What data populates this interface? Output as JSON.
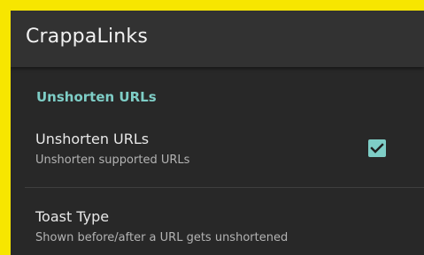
{
  "app": {
    "title": "CrappaLinks"
  },
  "section": {
    "header": "Unshorten URLs"
  },
  "preferences": [
    {
      "title": "Unshorten URLs",
      "summary": "Unshorten supported URLs",
      "checked": true
    },
    {
      "title": "Toast Type",
      "summary": "Shown before/after a URL gets unshortened"
    }
  ],
  "colors": {
    "accent": "#7ecdc6",
    "background": "#282828",
    "appbar": "#323232",
    "border": "#f7e600"
  },
  "icons": {
    "checkbox": "check-icon"
  }
}
